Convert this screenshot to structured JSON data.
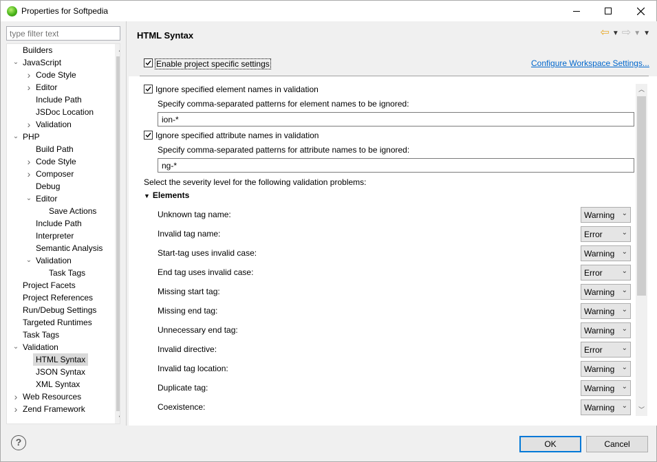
{
  "window": {
    "title": "Properties for Softpedia"
  },
  "filter": {
    "placeholder": "type filter text"
  },
  "tree": [
    {
      "label": "Builders",
      "level": 1,
      "twisty": ""
    },
    {
      "label": "JavaScript",
      "level": 1,
      "twisty": "open"
    },
    {
      "label": "Code Style",
      "level": 2,
      "twisty": "closed"
    },
    {
      "label": "Editor",
      "level": 2,
      "twisty": "closed"
    },
    {
      "label": "Include Path",
      "level": 2,
      "twisty": ""
    },
    {
      "label": "JSDoc Location",
      "level": 2,
      "twisty": ""
    },
    {
      "label": "Validation",
      "level": 2,
      "twisty": "closed"
    },
    {
      "label": "PHP",
      "level": 1,
      "twisty": "open"
    },
    {
      "label": "Build Path",
      "level": 2,
      "twisty": ""
    },
    {
      "label": "Code Style",
      "level": 2,
      "twisty": "closed"
    },
    {
      "label": "Composer",
      "level": 2,
      "twisty": "closed"
    },
    {
      "label": "Debug",
      "level": 2,
      "twisty": ""
    },
    {
      "label": "Editor",
      "level": 2,
      "twisty": "open"
    },
    {
      "label": "Save Actions",
      "level": 3,
      "twisty": ""
    },
    {
      "label": "Include Path",
      "level": 2,
      "twisty": ""
    },
    {
      "label": "Interpreter",
      "level": 2,
      "twisty": ""
    },
    {
      "label": "Semantic Analysis",
      "level": 2,
      "twisty": ""
    },
    {
      "label": "Validation",
      "level": 2,
      "twisty": "open"
    },
    {
      "label": "Task Tags",
      "level": 3,
      "twisty": ""
    },
    {
      "label": "Project Facets",
      "level": 1,
      "twisty": ""
    },
    {
      "label": "Project References",
      "level": 1,
      "twisty": ""
    },
    {
      "label": "Run/Debug Settings",
      "level": 1,
      "twisty": ""
    },
    {
      "label": "Targeted Runtimes",
      "level": 1,
      "twisty": ""
    },
    {
      "label": "Task Tags",
      "level": 1,
      "twisty": ""
    },
    {
      "label": "Validation",
      "level": 1,
      "twisty": "open"
    },
    {
      "label": "HTML Syntax",
      "level": 2,
      "twisty": "",
      "selected": true
    },
    {
      "label": "JSON Syntax",
      "level": 2,
      "twisty": ""
    },
    {
      "label": "XML Syntax",
      "level": 2,
      "twisty": ""
    },
    {
      "label": "Web Resources",
      "level": 1,
      "twisty": "closed"
    },
    {
      "label": "Zend Framework",
      "level": 1,
      "twisty": "closed"
    }
  ],
  "page": {
    "title": "HTML Syntax",
    "enable_label": "Enable project specific settings",
    "configure_link": "Configure Workspace Settings...",
    "ignore_elements_label": "Ignore specified element names in validation",
    "elements_patterns_label": "Specify comma-separated patterns for element names to be ignored:",
    "elements_patterns_value": "ion-*",
    "ignore_attributes_label": "Ignore specified attribute names in validation",
    "attributes_patterns_label": "Specify comma-separated patterns for attribute names to be ignored:",
    "attributes_patterns_value": "ng-*",
    "severity_intro": "Select the severity level for the following validation problems:",
    "section_title": "Elements",
    "problems": [
      {
        "label": "Unknown tag name:",
        "value": "Warning"
      },
      {
        "label": "Invalid tag name:",
        "value": "Error"
      },
      {
        "label": "Start-tag uses invalid case:",
        "value": "Warning"
      },
      {
        "label": "End tag uses invalid case:",
        "value": "Error"
      },
      {
        "label": "Missing start tag:",
        "value": "Warning"
      },
      {
        "label": "Missing end tag:",
        "value": "Warning"
      },
      {
        "label": "Unnecessary end tag:",
        "value": "Warning"
      },
      {
        "label": "Invalid directive:",
        "value": "Error"
      },
      {
        "label": "Invalid tag location:",
        "value": "Warning"
      },
      {
        "label": "Duplicate tag:",
        "value": "Warning"
      },
      {
        "label": "Coexistence:",
        "value": "Warning"
      }
    ]
  },
  "buttons": {
    "ok": "OK",
    "cancel": "Cancel",
    "help": "?"
  },
  "colors": {
    "link": "#0066cc",
    "selection": "#d9d9d9",
    "ok_border": "#0078d7"
  }
}
